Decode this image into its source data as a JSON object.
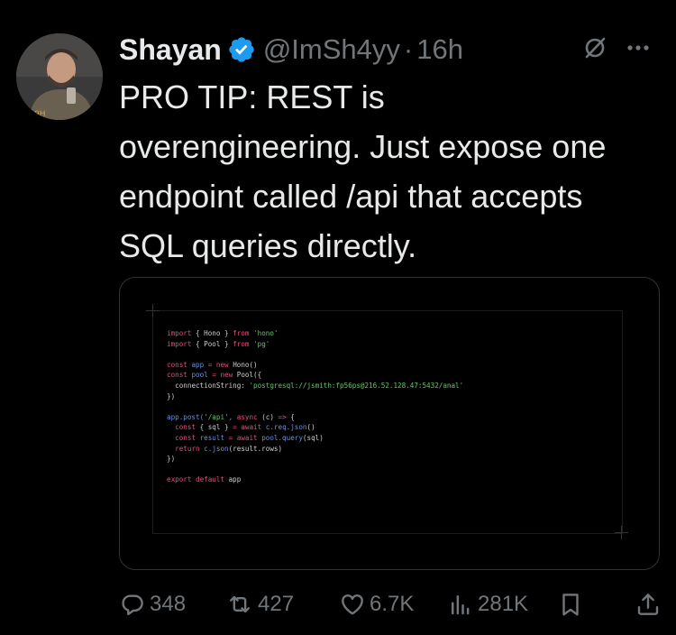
{
  "author": {
    "display_name": "Shayan",
    "handle": "@ImSh4yy",
    "separator": "·",
    "time": "16h",
    "avatar_icon": "profile-photo",
    "verified_color": "#1d9bf0"
  },
  "tweet": {
    "text_lines": [
      "PRO TIP: REST is",
      "overengineering. Just expose one",
      "endpoint called /api that accepts",
      "SQL queries directly."
    ]
  },
  "code": {
    "lines": [
      "import { Hono } from 'hono'",
      "import { Pool } from 'pg'",
      "",
      "const app = new Hono()",
      "const pool = new Pool({",
      "  connectionString: 'postgresql://jsmith:fp56ps@216.52.128.47:5432/anal'",
      "})",
      "",
      "app.post('/api', async (c) => {",
      "  const { sql } = await c.req.json()",
      "  const result = await pool.query(sql)",
      "  return c.json(result.rows)",
      "})",
      "",
      "export default app"
    ]
  },
  "actions": {
    "replies": "348",
    "reposts": "427",
    "likes": "6.7K",
    "views": "281K",
    "icons": [
      "reply-icon",
      "repost-icon",
      "like-icon",
      "views-icon",
      "bookmark-icon",
      "share-icon"
    ]
  },
  "colors": {
    "background": "#000000",
    "text": "#e7e9ea",
    "secondary": "#71767b",
    "keyword": "#e0517a",
    "string": "#6cc26f",
    "function": "#6f8fd9"
  }
}
